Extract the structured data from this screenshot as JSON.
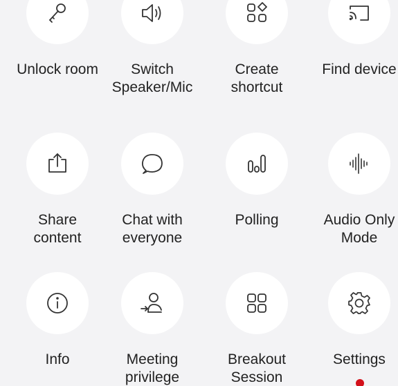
{
  "menu": {
    "items": [
      {
        "label": "Unlock room",
        "icon": "key-icon"
      },
      {
        "label": "Switch\nSpeaker/Mic",
        "icon": "speaker-icon"
      },
      {
        "label": "Create\nshortcut",
        "icon": "shortcut-icon"
      },
      {
        "label": "Find device",
        "icon": "cast-icon"
      },
      {
        "label": "Share\ncontent",
        "icon": "share-icon"
      },
      {
        "label": "Chat with\neveryone",
        "icon": "chat-icon"
      },
      {
        "label": "Polling",
        "icon": "polling-icon"
      },
      {
        "label": "Audio Only\nMode",
        "icon": "audio-wave-icon"
      },
      {
        "label": "Info",
        "icon": "info-icon"
      },
      {
        "label": "Meeting\nprivilege",
        "icon": "meeting-privilege-icon"
      },
      {
        "label": "Breakout\nSession",
        "icon": "breakout-icon"
      },
      {
        "label": "Settings",
        "icon": "gear-icon"
      }
    ]
  },
  "colors": {
    "background": "#f3f3f5",
    "tile": "#ffffff",
    "text": "#222222",
    "icon": "#333333",
    "accent": "#d3101a"
  }
}
